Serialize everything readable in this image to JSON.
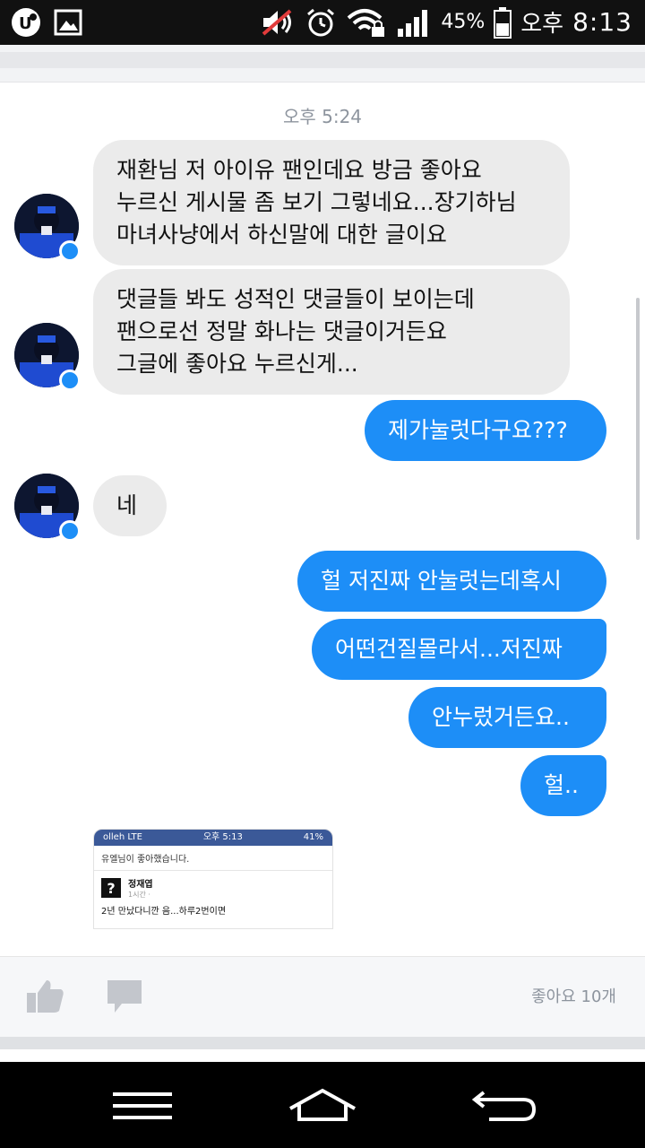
{
  "status_bar": {
    "battery": "45%",
    "ampm": "오후",
    "time": "8:13"
  },
  "conversation": {
    "timestamp": "오후 5:24",
    "messages": [
      {
        "dir": "in",
        "text": "재환님 저 아이유 팬인데요 방금 좋아요\n누르신 게시물 좀 보기 그렇네요...장기하님\n마녀사냥에서 하신말에 대한 글이요"
      },
      {
        "dir": "in",
        "text": "댓글들 봐도 성적인 댓글들이 보이는데\n팬으로선 정말 화나는 댓글이거든요\n그글에 좋아요 누르신게..."
      },
      {
        "dir": "out",
        "text": "제가눌럿다구요???"
      },
      {
        "dir": "in",
        "text": "네"
      },
      {
        "dir": "out",
        "text": "헐 저진짜 안눌럿는데혹시"
      },
      {
        "dir": "out",
        "text": "어떤건질몰라서...저진짜"
      },
      {
        "dir": "out",
        "text": "안누렀거든요.."
      },
      {
        "dir": "out",
        "text": "헐.."
      }
    ]
  },
  "attachment": {
    "carrier": "olleh  LTE",
    "time": "오후 5:13",
    "battery": "41%",
    "header": "유엘님이 좋아했습니다.",
    "name": "정재엽",
    "sub": "1시간 · ",
    "text": "2년 만났다니깐 음...하루2번이면"
  },
  "action_bar": {
    "likes_count": "좋아요 10개"
  }
}
